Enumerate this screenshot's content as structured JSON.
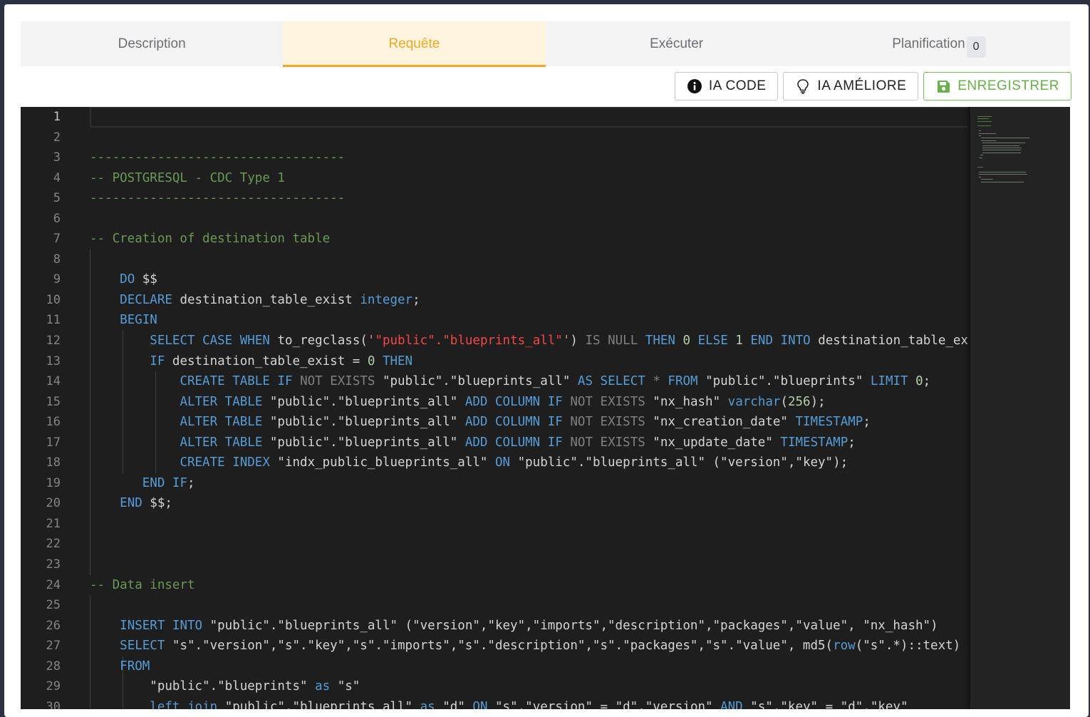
{
  "tabs": [
    {
      "label": "Description",
      "active": false
    },
    {
      "label": "Requête",
      "active": true
    },
    {
      "label": "Exécuter",
      "active": false
    },
    {
      "label": "Planification",
      "active": false,
      "badge": "0"
    }
  ],
  "toolbar": {
    "ia_code_label": "IA CODE",
    "ia_ameliore_label": "IA AMÉLIORE",
    "save_label": "ENREGISTRER"
  },
  "colors": {
    "accent": "#f5a623",
    "save": "#6ab04c",
    "editor_bg": "#1e1e1e",
    "keyword": "#569cd6",
    "comment": "#6a9955",
    "string": "#ce9178",
    "error_string": "#f44747"
  },
  "editor": {
    "current_line": 1,
    "line_numbers": [
      "1",
      "2",
      "3",
      "4",
      "5",
      "6",
      "7",
      "8",
      "9",
      "10",
      "11",
      "12",
      "13",
      "14",
      "15",
      "16",
      "17",
      "18",
      "19",
      "20",
      "21",
      "22",
      "23",
      "24",
      "25",
      "26",
      "27",
      "28",
      "29",
      "30"
    ],
    "lines": [
      [],
      [],
      [
        [
          "c",
          "----------------------------------"
        ]
      ],
      [
        [
          "c",
          "-- POSTGRESQL - CDC Type 1"
        ]
      ],
      [
        [
          "c",
          "----------------------------------"
        ]
      ],
      [],
      [
        [
          "c",
          "-- Creation of destination table"
        ]
      ],
      [],
      [
        [
          "w",
          "    "
        ],
        [
          "k",
          "DO"
        ],
        [
          "w",
          " $$"
        ]
      ],
      [
        [
          "w",
          "    "
        ],
        [
          "k",
          "DECLARE"
        ],
        [
          "w",
          " destination_table_exist "
        ],
        [
          "k",
          "integer"
        ],
        [
          "w",
          ";"
        ]
      ],
      [
        [
          "w",
          "    "
        ],
        [
          "k",
          "BEGIN"
        ]
      ],
      [
        [
          "w",
          "        "
        ],
        [
          "k",
          "SELECT"
        ],
        [
          "w",
          " "
        ],
        [
          "k",
          "CASE"
        ],
        [
          "w",
          " "
        ],
        [
          "k",
          "WHEN"
        ],
        [
          "w",
          " to_regclass("
        ],
        [
          "s",
          "'"
        ],
        [
          "r",
          "\"public\".\"blueprints_all\""
        ],
        [
          "s",
          "'"
        ],
        [
          "w",
          ") "
        ],
        [
          "g",
          "IS"
        ],
        [
          "w",
          " "
        ],
        [
          "g",
          "NULL"
        ],
        [
          "w",
          " "
        ],
        [
          "k",
          "THEN"
        ],
        [
          "w",
          " "
        ],
        [
          "n",
          "0"
        ],
        [
          "w",
          " "
        ],
        [
          "k",
          "ELSE"
        ],
        [
          "w",
          " "
        ],
        [
          "n",
          "1"
        ],
        [
          "w",
          " "
        ],
        [
          "k",
          "END"
        ],
        [
          "w",
          " "
        ],
        [
          "k",
          "INTO"
        ],
        [
          "w",
          " destination_table_exist;"
        ]
      ],
      [
        [
          "w",
          "        "
        ],
        [
          "k",
          "IF"
        ],
        [
          "w",
          " destination_table_exist = "
        ],
        [
          "n",
          "0"
        ],
        [
          "w",
          " "
        ],
        [
          "k",
          "THEN"
        ]
      ],
      [
        [
          "w",
          "            "
        ],
        [
          "k",
          "CREATE"
        ],
        [
          "w",
          " "
        ],
        [
          "k",
          "TABLE"
        ],
        [
          "w",
          " "
        ],
        [
          "k",
          "IF"
        ],
        [
          "w",
          " "
        ],
        [
          "g",
          "NOT"
        ],
        [
          "w",
          " "
        ],
        [
          "g",
          "EXISTS"
        ],
        [
          "w",
          " \"public\".\"blueprints_all\" "
        ],
        [
          "k",
          "AS"
        ],
        [
          "w",
          " "
        ],
        [
          "k",
          "SELECT"
        ],
        [
          "w",
          " "
        ],
        [
          "g",
          "*"
        ],
        [
          "w",
          " "
        ],
        [
          "k",
          "FROM"
        ],
        [
          "w",
          " \"public\".\"blueprints\" "
        ],
        [
          "k",
          "LIMIT"
        ],
        [
          "w",
          " "
        ],
        [
          "n",
          "0"
        ],
        [
          "w",
          ";"
        ]
      ],
      [
        [
          "w",
          "            "
        ],
        [
          "k",
          "ALTER"
        ],
        [
          "w",
          " "
        ],
        [
          "k",
          "TABLE"
        ],
        [
          "w",
          " \"public\".\"blueprints_all\" "
        ],
        [
          "k",
          "ADD"
        ],
        [
          "w",
          " "
        ],
        [
          "k",
          "COLUMN"
        ],
        [
          "w",
          " "
        ],
        [
          "k",
          "IF"
        ],
        [
          "w",
          " "
        ],
        [
          "g",
          "NOT"
        ],
        [
          "w",
          " "
        ],
        [
          "g",
          "EXISTS"
        ],
        [
          "w",
          " \"nx_hash\" "
        ],
        [
          "k",
          "varchar"
        ],
        [
          "w",
          "("
        ],
        [
          "n",
          "256"
        ],
        [
          "w",
          ");"
        ]
      ],
      [
        [
          "w",
          "            "
        ],
        [
          "k",
          "ALTER"
        ],
        [
          "w",
          " "
        ],
        [
          "k",
          "TABLE"
        ],
        [
          "w",
          " \"public\".\"blueprints_all\" "
        ],
        [
          "k",
          "ADD"
        ],
        [
          "w",
          " "
        ],
        [
          "k",
          "COLUMN"
        ],
        [
          "w",
          " "
        ],
        [
          "k",
          "IF"
        ],
        [
          "w",
          " "
        ],
        [
          "g",
          "NOT"
        ],
        [
          "w",
          " "
        ],
        [
          "g",
          "EXISTS"
        ],
        [
          "w",
          " \"nx_creation_date\" "
        ],
        [
          "k",
          "TIMESTAMP"
        ],
        [
          "w",
          ";"
        ]
      ],
      [
        [
          "w",
          "            "
        ],
        [
          "k",
          "ALTER"
        ],
        [
          "w",
          " "
        ],
        [
          "k",
          "TABLE"
        ],
        [
          "w",
          " \"public\".\"blueprints_all\" "
        ],
        [
          "k",
          "ADD"
        ],
        [
          "w",
          " "
        ],
        [
          "k",
          "COLUMN"
        ],
        [
          "w",
          " "
        ],
        [
          "k",
          "IF"
        ],
        [
          "w",
          " "
        ],
        [
          "g",
          "NOT"
        ],
        [
          "w",
          " "
        ],
        [
          "g",
          "EXISTS"
        ],
        [
          "w",
          " \"nx_update_date\" "
        ],
        [
          "k",
          "TIMESTAMP"
        ],
        [
          "w",
          ";"
        ]
      ],
      [
        [
          "w",
          "            "
        ],
        [
          "k",
          "CREATE"
        ],
        [
          "w",
          " "
        ],
        [
          "k",
          "INDEX"
        ],
        [
          "w",
          " \"indx_public_blueprints_all\" "
        ],
        [
          "k",
          "ON"
        ],
        [
          "w",
          " \"public\".\"blueprints_all\" (\"version\",\"key\");"
        ]
      ],
      [
        [
          "w",
          "       "
        ],
        [
          "k",
          "END"
        ],
        [
          "w",
          " "
        ],
        [
          "k",
          "IF"
        ],
        [
          "w",
          ";"
        ]
      ],
      [
        [
          "w",
          "    "
        ],
        [
          "k",
          "END"
        ],
        [
          "w",
          " $$;"
        ]
      ],
      [],
      [],
      [],
      [
        [
          "c",
          "-- Data insert"
        ]
      ],
      [],
      [
        [
          "w",
          "    "
        ],
        [
          "k",
          "INSERT"
        ],
        [
          "w",
          " "
        ],
        [
          "k",
          "INTO"
        ],
        [
          "w",
          " \"public\".\"blueprints_all\" (\"version\",\"key\",\"imports\",\"description\",\"packages\",\"value\", \"nx_hash\")"
        ]
      ],
      [
        [
          "w",
          "    "
        ],
        [
          "k",
          "SELECT"
        ],
        [
          "w",
          " \"s\".\"version\",\"s\".\"key\",\"s\".\"imports\",\"s\".\"description\",\"s\".\"packages\",\"s\".\"value\", md5("
        ],
        [
          "k",
          "row"
        ],
        [
          "w",
          "(\"s\".*)::text)"
        ]
      ],
      [
        [
          "w",
          "    "
        ],
        [
          "k",
          "FROM"
        ]
      ],
      [
        [
          "w",
          "        \"public\".\"blueprints\" "
        ],
        [
          "k",
          "as"
        ],
        [
          "w",
          " \"s\""
        ]
      ],
      [
        [
          "w",
          "        "
        ],
        [
          "k",
          "left"
        ],
        [
          "w",
          " "
        ],
        [
          "k",
          "join"
        ],
        [
          "w",
          " \"public\".\"blueprints_all\" "
        ],
        [
          "k",
          "as"
        ],
        [
          "w",
          " \"d\" "
        ],
        [
          "k",
          "ON"
        ],
        [
          "w",
          " \"s\".\"version\" = \"d\".\"version\" "
        ],
        [
          "k",
          "AND"
        ],
        [
          "w",
          " \"s\".\"key\" = \"d\".\"key\""
        ]
      ]
    ]
  }
}
